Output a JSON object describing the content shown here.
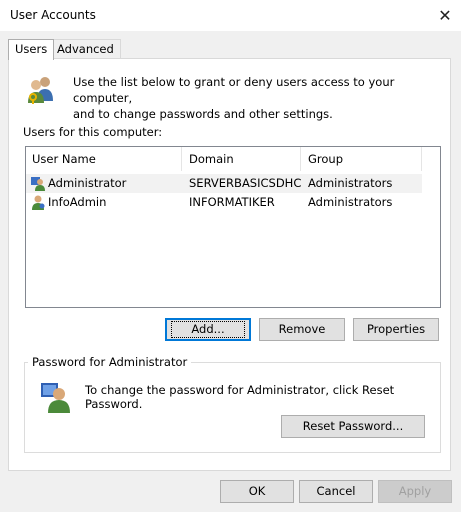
{
  "window": {
    "title": "User Accounts",
    "close_glyph": "✕"
  },
  "tabs": [
    {
      "label": "Users",
      "active": true
    },
    {
      "label": "Advanced",
      "active": false
    }
  ],
  "intro": {
    "line1": "Use the list below to grant or deny users access to your computer,",
    "line2": "and to change passwords and other settings.",
    "icon": "users-keys-icon"
  },
  "users_label": "Users for this computer:",
  "users_table": {
    "columns": [
      "User Name",
      "Domain",
      "Group"
    ],
    "rows": [
      {
        "name": "Administrator",
        "domain": "SERVERBASICSDHC",
        "group": "Administrators",
        "selected": true
      },
      {
        "name": "InfoAdmin",
        "domain": "INFORMATIKER",
        "group": "Administrators",
        "selected": false
      }
    ]
  },
  "list_buttons": {
    "add": "Add...",
    "remove": "Remove",
    "properties": "Properties"
  },
  "password_group": {
    "title": "Password for Administrator",
    "text": "To change the password for Administrator, click Reset Password.",
    "reset_button": "Reset Password..."
  },
  "dialog_buttons": {
    "ok": "OK",
    "cancel": "Cancel",
    "apply": "Apply"
  },
  "colors": {
    "focus_border": "#0078d7",
    "selection": "#f2f2f2"
  }
}
